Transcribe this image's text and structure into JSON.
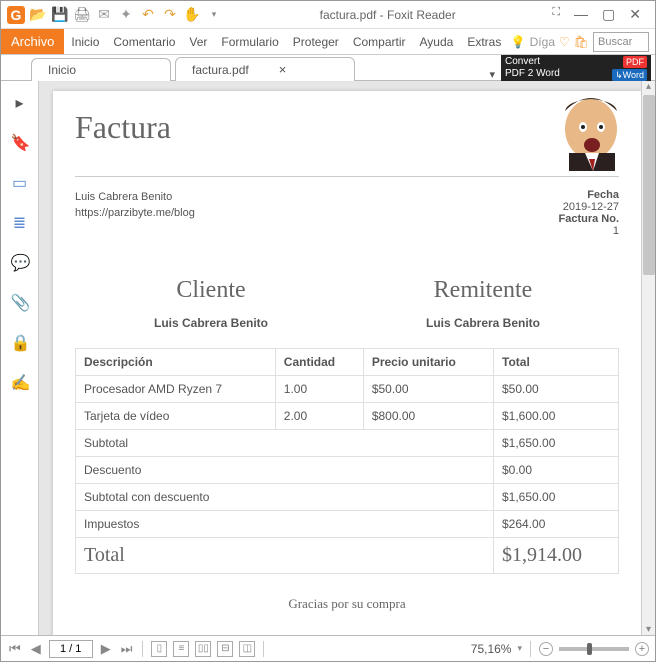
{
  "titlebar": {
    "title": "factura.pdf - Foxit Reader"
  },
  "menu": {
    "archivo": "Archivo",
    "items": [
      "Inicio",
      "Comentario",
      "Ver",
      "Formulario",
      "Proteger",
      "Compartir",
      "Ayuda",
      "Extras"
    ],
    "tell": "Díga",
    "search_placeholder": "Buscar"
  },
  "tabs": {
    "home": "Inicio",
    "file": "factura.pdf"
  },
  "promo": {
    "line1": "Convert",
    "line2": "PDF 2 Word",
    "badge1": "PDF",
    "badge2": "Word"
  },
  "invoice": {
    "title": "Factura",
    "issuer_name": "Luis Cabrera Benito",
    "issuer_url": "https://parzibyte.me/blog",
    "date_label": "Fecha",
    "date": "2019-12-27",
    "numlabel": "Factura No.",
    "num": "1",
    "client_title": "Cliente",
    "client_name": "Luis Cabrera Benito",
    "sender_title": "Remitente",
    "sender_name": "Luis Cabrera Benito",
    "headers": {
      "desc": "Descripción",
      "qty": "Cantidad",
      "unit": "Precio unitario",
      "total": "Total"
    },
    "rows": [
      {
        "desc": "Procesador AMD Ryzen 7",
        "qty": "1.00",
        "unit": "$50.00",
        "total": "$50.00"
      },
      {
        "desc": "Tarjeta de vídeo",
        "qty": "2.00",
        "unit": "$800.00",
        "total": "$1,600.00"
      }
    ],
    "sub_label": "Subtotal",
    "sub_val": "$1,650.00",
    "disc_label": "Descuento",
    "disc_val": "$0.00",
    "subd_label": "Subtotal con descuento",
    "subd_val": "$1,650.00",
    "tax_label": "Impuestos",
    "tax_val": "$264.00",
    "total_label": "Total",
    "total_val": "$1,914.00",
    "thanks": "Gracias por su compra"
  },
  "status": {
    "page": "1 / 1",
    "zoom": "75,16%"
  }
}
